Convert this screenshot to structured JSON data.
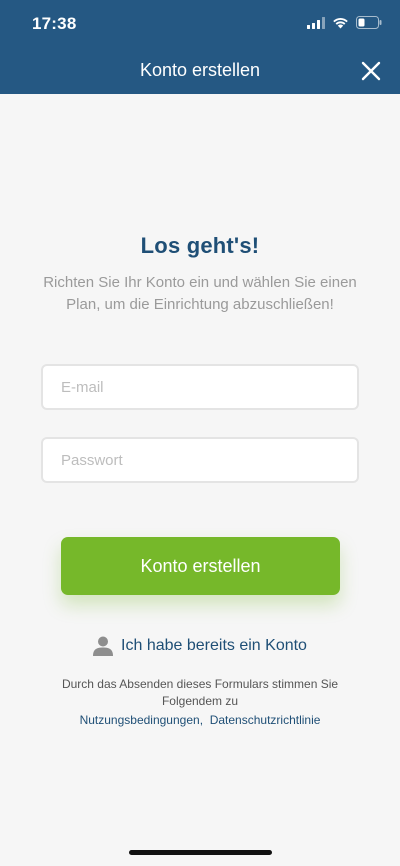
{
  "status_bar": {
    "time": "17:38"
  },
  "nav": {
    "title": "Konto erstellen",
    "close_icon": "close-icon"
  },
  "intro": {
    "headline": "Los geht's!",
    "subtitle": "Richten Sie Ihr Konto ein und wählen Sie einen Plan, um die Einrichtung abzuschließen!"
  },
  "form": {
    "email_placeholder": "E-mail",
    "email_value": "",
    "password_placeholder": "Passwort",
    "password_value": "",
    "submit_label": "Konto erstellen"
  },
  "login": {
    "icon": "user-icon",
    "label": "Ich habe bereits ein Konto"
  },
  "legal": {
    "notice": "Durch das Absenden dieses Formulars stimmen Sie Folgendem zu",
    "terms_link": "Nutzungsbedingungen",
    "separator": ",",
    "privacy_link": "Datenschutzrichtlinie"
  },
  "colors": {
    "header_bg": "#255883",
    "accent_green": "#76b82a",
    "link_blue": "#1f4f76",
    "background": "#f6f6f6"
  }
}
